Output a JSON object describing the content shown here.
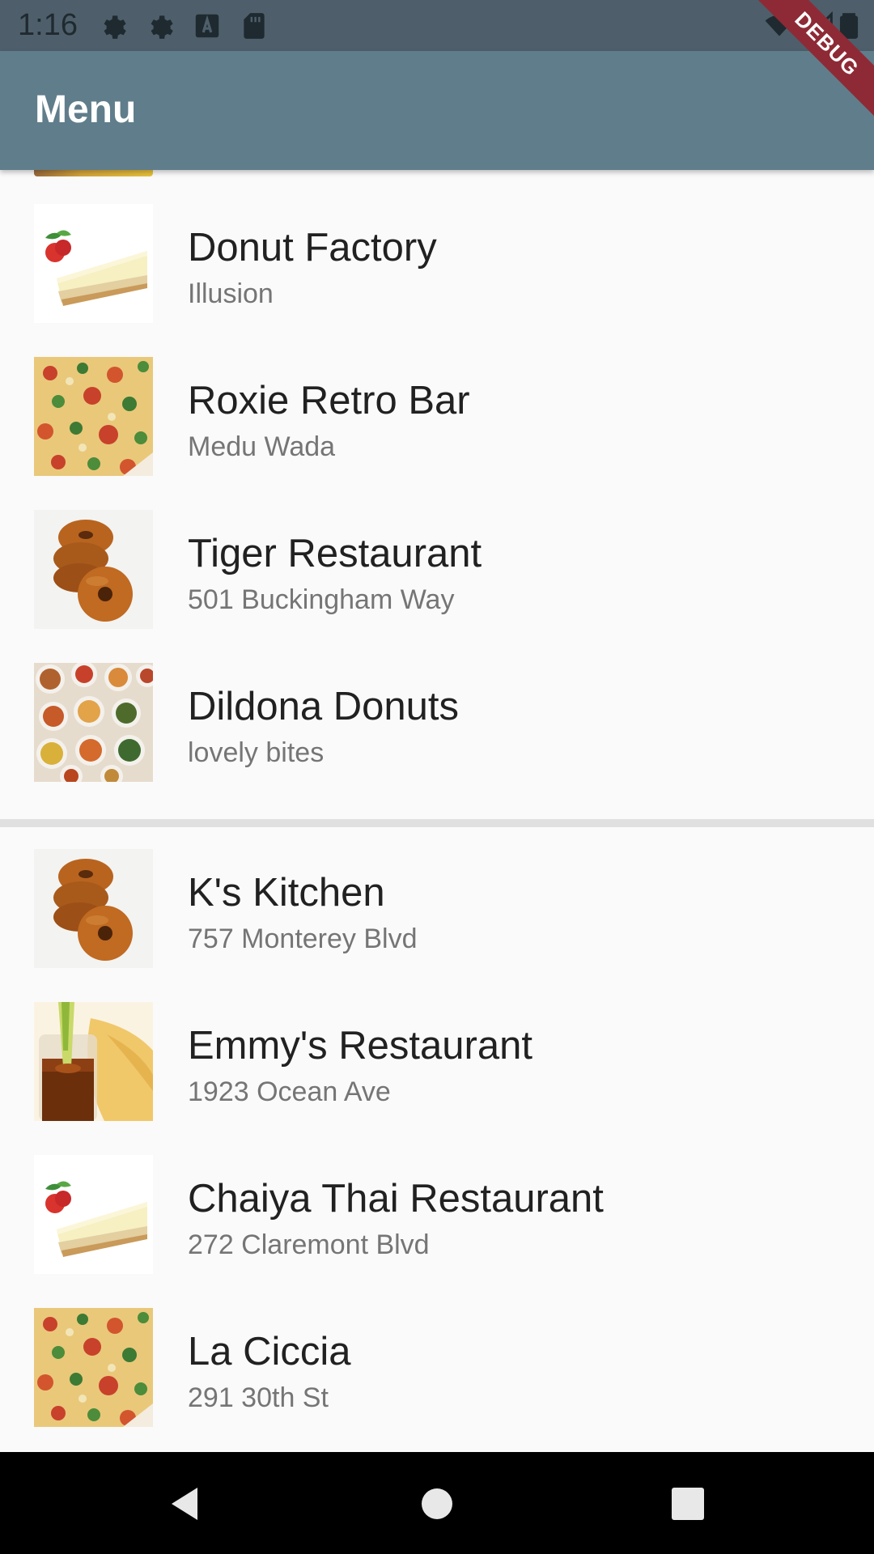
{
  "status_bar": {
    "time": "1:16",
    "icons": [
      "settings-icon",
      "settings-icon",
      "a-text-icon",
      "sd-card-icon",
      "wifi-icon",
      "signal-icon",
      "battery-icon"
    ]
  },
  "debug_banner": "DEBUG",
  "app_bar": {
    "title": "Menu",
    "color": "#607d8b"
  },
  "list": {
    "section1": [
      {
        "title": "Donut Factory",
        "subtitle": "Illusion",
        "image": "cheesecake"
      },
      {
        "title": "Roxie Retro Bar",
        "subtitle": "Medu Wada",
        "image": "pizza"
      },
      {
        "title": "Tiger Restaurant",
        "subtitle": "501 Buckingham Way",
        "image": "donuts"
      },
      {
        "title": "Dildona Donuts",
        "subtitle": "lovely bites",
        "image": "dishes"
      }
    ],
    "section2": [
      {
        "title": "K's Kitchen",
        "subtitle": "757 Monterey Blvd",
        "image": "donuts"
      },
      {
        "title": "Emmy's Restaurant",
        "subtitle": "1923 Ocean Ave",
        "image": "chips-dip"
      },
      {
        "title": "Chaiya Thai Restaurant",
        "subtitle": "272 Claremont Blvd",
        "image": "cheesecake"
      },
      {
        "title": "La Ciccia",
        "subtitle": "291 30th St",
        "image": "pizza"
      }
    ]
  },
  "nav_bar": {
    "buttons": [
      "back-icon",
      "home-icon",
      "recents-icon"
    ]
  }
}
